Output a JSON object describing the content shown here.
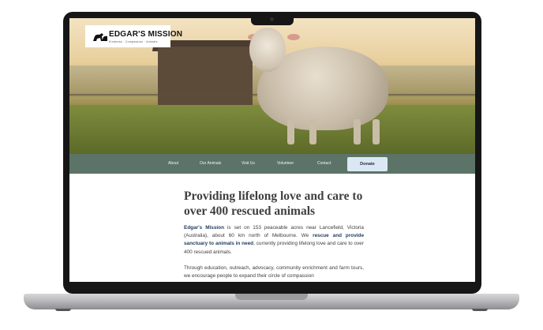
{
  "logo": {
    "title": "EDGAR'S MISSION",
    "tagline": "Kindness · Compassion · Animals"
  },
  "nav": {
    "items": [
      "About",
      "Our Animals",
      "Visit Us",
      "Volunteer",
      "Contact"
    ],
    "donate": "Donate"
  },
  "headline": "Providing lifelong love and care to over 400 rescued animals",
  "intro": {
    "p1_name": "Edgar's Mission",
    "p1_a": " is set on 153 peaceable acres near Lancefield, Victoria (Australia), about 60 km north of Melbourne. We ",
    "p1_strong": "rescue and provide sanctuary to animals in need",
    "p1_b": ", currently providing lifelong love and care to over 400 rescued animals.",
    "p2": "Through education, outreach, advocacy, community enrichment and farm tours, we encourage people to expand their circle of compassion"
  },
  "colors": {
    "nav": "#5b7467",
    "donate_bg": "#dbe8f4",
    "accent_text": "#1f3a5b"
  },
  "icons": {
    "logo": "animals-logo-icon"
  }
}
